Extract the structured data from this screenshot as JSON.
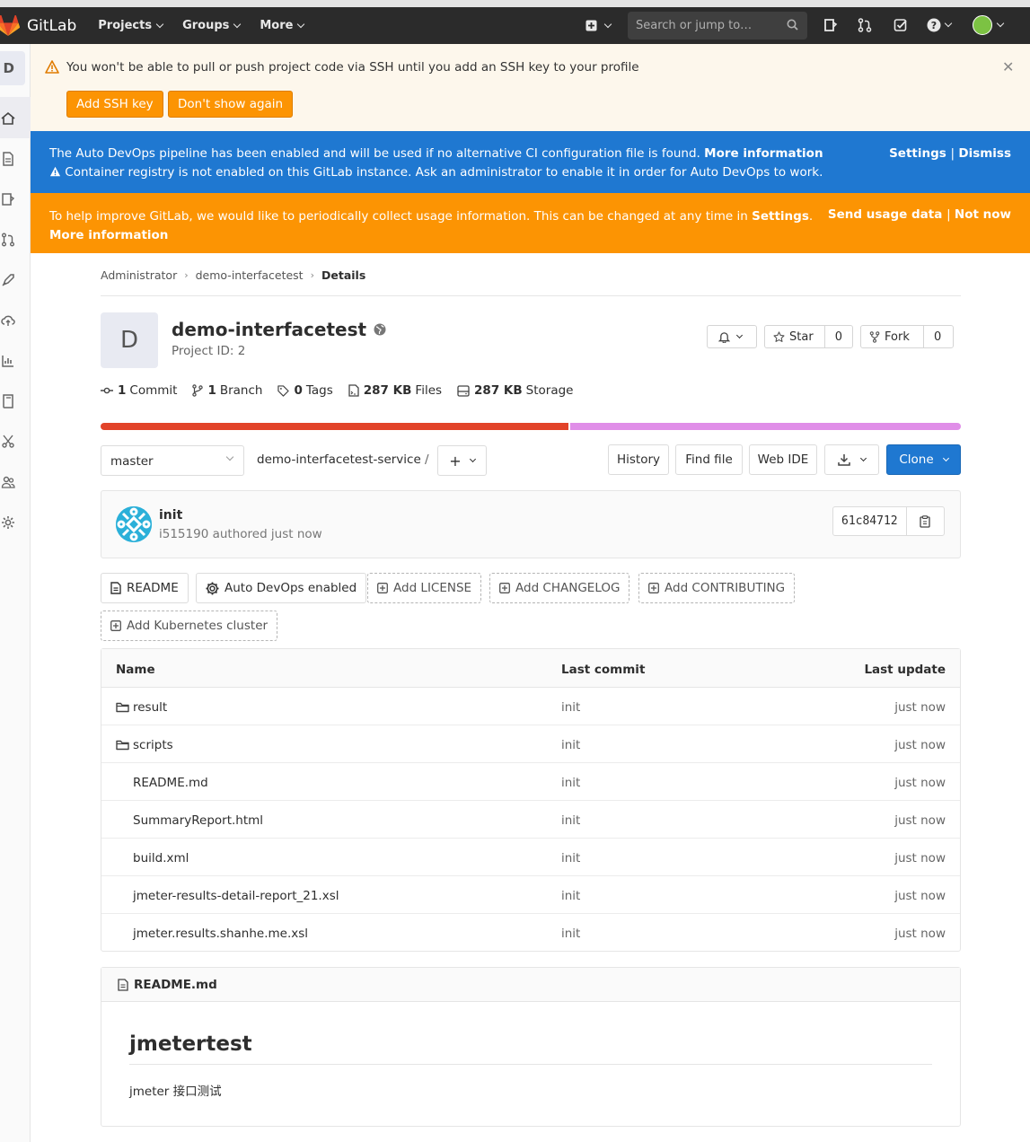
{
  "navbar": {
    "logo_text": "GitLab",
    "menu": [
      "Projects",
      "Groups",
      "More"
    ],
    "search_placeholder": "Search or jump to…",
    "icons": [
      "plus-icon",
      "search-icon",
      "todo-icon",
      "merge-request-icon",
      "issues-icon",
      "help-icon",
      "avatar"
    ]
  },
  "sidebar": {
    "project_letter": "D"
  },
  "ssh_alert": {
    "text": "You won't be able to pull or push project code via SSH until you add an SSH key to your profile",
    "add_key_label": "Add SSH key",
    "dont_show_label": "Don't show again"
  },
  "devops_alert": {
    "line1": "The Auto DevOps pipeline has been enabled and will be used if no alternative CI configuration file is found.",
    "line1_link": "More information",
    "line2": "Container registry is not enabled on this GitLab instance. Ask an administrator to enable it in order for Auto DevOps to work.",
    "settings": "Settings",
    "dismiss": "Dismiss"
  },
  "usage_alert": {
    "text": "To help improve GitLab, we would like to periodically collect usage information. This can be changed at any time in",
    "settings_link": "Settings",
    "more_link": "More information",
    "send": "Send usage data",
    "not_now": "Not now"
  },
  "breadcrumb": [
    "Administrator",
    "demo-interfacetest",
    "Details"
  ],
  "project": {
    "avatar_letter": "D",
    "name": "demo-interfacetest",
    "id_text": "Project ID: 2",
    "star_label": "Star",
    "star_count": "0",
    "fork_label": "Fork",
    "fork_count": "0"
  },
  "stats": {
    "commits_num": "1",
    "commits_label": "Commit",
    "branches_num": "1",
    "branches_label": "Branch",
    "tags_num": "0",
    "tags_label": "Tags",
    "files_num": "287 KB",
    "files_label": "Files",
    "storage_num": "287 KB",
    "storage_label": "Storage"
  },
  "languages": [
    {
      "share": 54.5,
      "color": "#e24329"
    },
    {
      "share": 45.5,
      "color": "#e08ee8"
    }
  ],
  "repo_bar": {
    "branch": "master",
    "path": "demo-interfacetest-service",
    "slash": "/",
    "history": "History",
    "find_file": "Find file",
    "web_ide": "Web IDE",
    "clone": "Clone"
  },
  "last_commit": {
    "title": "init",
    "meta": "i515190 authored just now",
    "sha": "61c84712"
  },
  "quick_actions": {
    "readme": "README",
    "auto_devops": "Auto DevOps enabled",
    "add_license": "Add LICENSE",
    "add_changelog": "Add CHANGELOG",
    "add_contributing": "Add CONTRIBUTING",
    "add_k8s": "Add Kubernetes cluster"
  },
  "file_table": {
    "headers": {
      "name": "Name",
      "commit": "Last commit",
      "update": "Last update"
    },
    "rows": [
      {
        "name": "result",
        "type": "folder",
        "commit": "init",
        "update": "just now"
      },
      {
        "name": "scripts",
        "type": "folder",
        "commit": "init",
        "update": "just now"
      },
      {
        "name": "README.md",
        "type": "file",
        "commit": "init",
        "update": "just now"
      },
      {
        "name": "SummaryReport.html",
        "type": "file",
        "commit": "init",
        "update": "just now"
      },
      {
        "name": "build.xml",
        "type": "file",
        "commit": "init",
        "update": "just now"
      },
      {
        "name": "jmeter-results-detail-report_21.xsl",
        "type": "file",
        "commit": "init",
        "update": "just now"
      },
      {
        "name": "jmeter.results.shanhe.me.xsl",
        "type": "file",
        "commit": "init",
        "update": "just now"
      }
    ]
  },
  "readme": {
    "filename": "README.md",
    "heading": "jmetertest",
    "body": "jmeter 接口测试"
  }
}
